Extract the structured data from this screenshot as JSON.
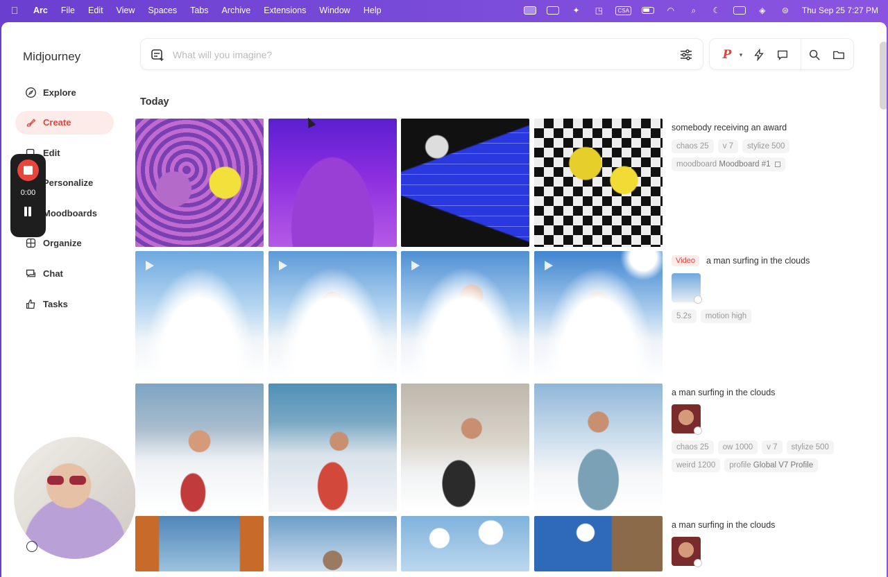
{
  "menubar": {
    "app": "Arc",
    "items": [
      "File",
      "Edit",
      "View",
      "Spaces",
      "Tabs",
      "Archive",
      "Extensions",
      "Window",
      "Help"
    ],
    "status_text_badge": "CSA",
    "clock": "Thu Sep 25  7:27 PM"
  },
  "sidebar": {
    "logo": "Midjourney",
    "items": [
      {
        "label": "Explore",
        "icon": "compass-icon"
      },
      {
        "label": "Create",
        "icon": "brush-icon",
        "active": true
      },
      {
        "label": "Edit",
        "icon": "edit-icon"
      },
      {
        "label": "Personalize",
        "icon": "sliders-icon"
      },
      {
        "label": "Moodboards",
        "icon": "moodboard-icon"
      },
      {
        "label": "Organize",
        "icon": "grid-icon"
      },
      {
        "label": "Chat",
        "icon": "chat-icon"
      },
      {
        "label": "Tasks",
        "icon": "thumbs-up-icon"
      }
    ]
  },
  "recorder": {
    "time": "0:00"
  },
  "prompt": {
    "placeholder": "What will you imagine?"
  },
  "toolbar": {
    "personalize_letter": "P",
    "chevron": "▾"
  },
  "feed": {
    "section": "Today",
    "rows": [
      {
        "title": "somebody receiving an award",
        "chips": [
          "chaos 25",
          "v 7",
          "stylize 500"
        ],
        "moodboard_prefix": "moodboard",
        "moodboard_name": "Moodboard #1"
      },
      {
        "badge": "Video",
        "title": "a man surfing in the clouds",
        "chips": [
          "5.2s",
          "motion high"
        ]
      },
      {
        "title": "a man surfing in the clouds",
        "chips": [
          "chaos 25",
          "ow 1000",
          "v 7",
          "stylize 500",
          "weird 1200"
        ],
        "profile_prefix": "profile",
        "profile_name": "Global V7 Profile"
      },
      {
        "title": "a man surfing in the clouds"
      }
    ]
  },
  "colors": {
    "accent": "#e0443c",
    "active_bg": "#fdebea"
  }
}
